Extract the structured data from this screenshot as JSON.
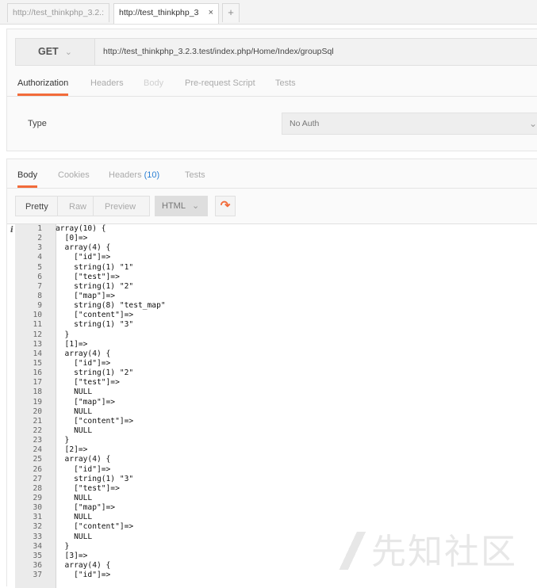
{
  "tabs": [
    {
      "label": "http://test_thinkphp_3.2.:"
    },
    {
      "label": "http://test_thinkphp_3",
      "close": "×"
    }
  ],
  "new_tab": "+",
  "request": {
    "method": "GET",
    "url": "http://test_thinkphp_3.2.3.test/index.php/Home/Index/groupSql",
    "subtabs": [
      "Authorization",
      "Headers",
      "Body",
      "Pre-request Script",
      "Tests"
    ],
    "auth_type_label": "Type",
    "auth_type_value": "No Auth"
  },
  "response": {
    "tabs": {
      "body": "Body",
      "cookies": "Cookies",
      "headers": "Headers",
      "headers_count": "(10)",
      "tests": "Tests"
    },
    "view_modes": [
      "Pretty",
      "Raw",
      "Preview"
    ],
    "format": "HTML",
    "lines": [
      "array(10) {",
      "  [0]=>",
      "  array(4) {",
      "    [\"id\"]=>",
      "    string(1) \"1\"",
      "    [\"test\"]=>",
      "    string(1) \"2\"",
      "    [\"map\"]=>",
      "    string(8) \"test_map\"",
      "    [\"content\"]=>",
      "    string(1) \"3\"",
      "  }",
      "  [1]=>",
      "  array(4) {",
      "    [\"id\"]=>",
      "    string(1) \"2\"",
      "    [\"test\"]=>",
      "    NULL",
      "    [\"map\"]=>",
      "    NULL",
      "    [\"content\"]=>",
      "    NULL",
      "  }",
      "  [2]=>",
      "  array(4) {",
      "    [\"id\"]=>",
      "    string(1) \"3\"",
      "    [\"test\"]=>",
      "    NULL",
      "    [\"map\"]=>",
      "    NULL",
      "    [\"content\"]=>",
      "    NULL",
      "  }",
      "  [3]=>",
      "  array(4) {",
      "    [\"id\"]=>"
    ]
  },
  "watermark": "先知社区",
  "colors": {
    "accent": "#f26b3a",
    "count": "#2a7fd4"
  }
}
